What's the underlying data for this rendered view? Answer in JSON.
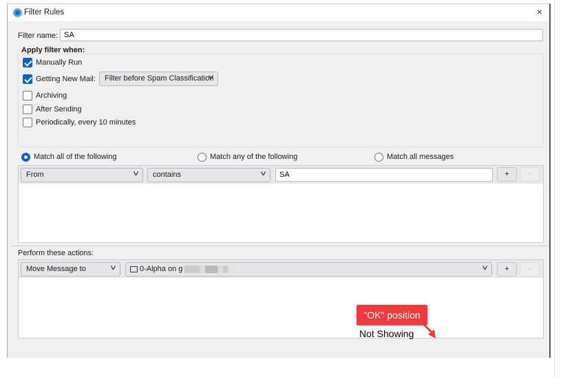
{
  "window": {
    "title": "Filter Rules",
    "close": "×"
  },
  "filter_name": {
    "label": "Filter name:",
    "value": "SA"
  },
  "apply": {
    "heading": "Apply filter when:",
    "options": [
      {
        "label": "Manually Run",
        "checked": true
      },
      {
        "label": "Getting New Mail:",
        "checked": true
      },
      {
        "label": "Archiving",
        "checked": false
      },
      {
        "label": "After Sending",
        "checked": false
      },
      {
        "label": "Periodically, every 10 minutes",
        "checked": false
      }
    ],
    "timing_select": "Filter before Spam Classification"
  },
  "match": {
    "options": [
      "Match all of the following",
      "Match any of the following",
      "Match all messages"
    ],
    "selected": 0
  },
  "rules": [
    {
      "field": "From",
      "operator": "contains",
      "value": "SA"
    }
  ],
  "actions": {
    "heading": "Perform these actions:",
    "items": [
      {
        "action": "Move Message to",
        "target": "0-Alpha on g"
      }
    ]
  },
  "buttons": {
    "add": "+",
    "remove": "-"
  },
  "annotation": {
    "label": "\"OK\" position",
    "note": "Not Showing",
    "color": "#ef3b3e"
  }
}
